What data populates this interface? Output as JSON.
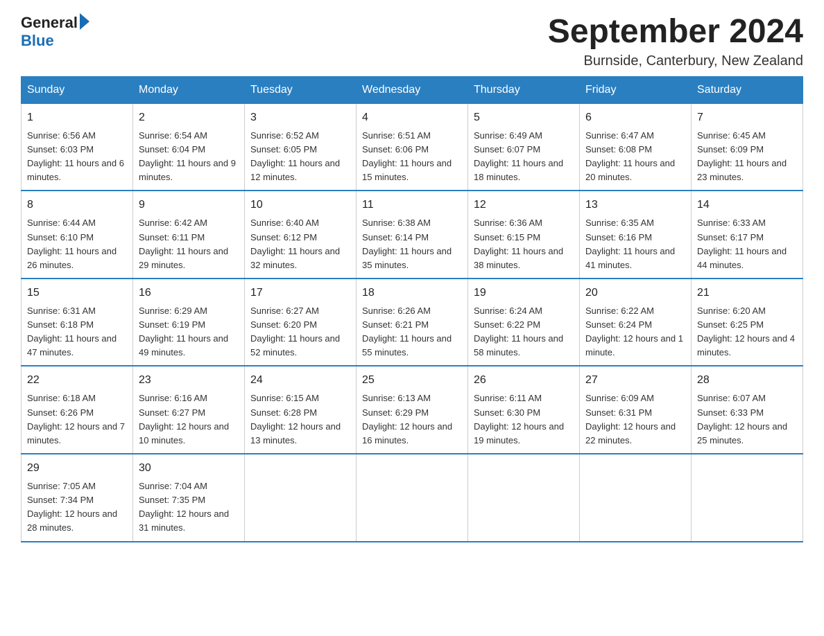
{
  "header": {
    "logo_text_black": "General",
    "logo_text_blue": "Blue",
    "month_title": "September 2024",
    "location": "Burnside, Canterbury, New Zealand"
  },
  "days_of_week": [
    "Sunday",
    "Monday",
    "Tuesday",
    "Wednesday",
    "Thursday",
    "Friday",
    "Saturday"
  ],
  "weeks": [
    [
      {
        "day": "1",
        "sunrise": "Sunrise: 6:56 AM",
        "sunset": "Sunset: 6:03 PM",
        "daylight": "Daylight: 11 hours and 6 minutes."
      },
      {
        "day": "2",
        "sunrise": "Sunrise: 6:54 AM",
        "sunset": "Sunset: 6:04 PM",
        "daylight": "Daylight: 11 hours and 9 minutes."
      },
      {
        "day": "3",
        "sunrise": "Sunrise: 6:52 AM",
        "sunset": "Sunset: 6:05 PM",
        "daylight": "Daylight: 11 hours and 12 minutes."
      },
      {
        "day": "4",
        "sunrise": "Sunrise: 6:51 AM",
        "sunset": "Sunset: 6:06 PM",
        "daylight": "Daylight: 11 hours and 15 minutes."
      },
      {
        "day": "5",
        "sunrise": "Sunrise: 6:49 AM",
        "sunset": "Sunset: 6:07 PM",
        "daylight": "Daylight: 11 hours and 18 minutes."
      },
      {
        "day": "6",
        "sunrise": "Sunrise: 6:47 AM",
        "sunset": "Sunset: 6:08 PM",
        "daylight": "Daylight: 11 hours and 20 minutes."
      },
      {
        "day": "7",
        "sunrise": "Sunrise: 6:45 AM",
        "sunset": "Sunset: 6:09 PM",
        "daylight": "Daylight: 11 hours and 23 minutes."
      }
    ],
    [
      {
        "day": "8",
        "sunrise": "Sunrise: 6:44 AM",
        "sunset": "Sunset: 6:10 PM",
        "daylight": "Daylight: 11 hours and 26 minutes."
      },
      {
        "day": "9",
        "sunrise": "Sunrise: 6:42 AM",
        "sunset": "Sunset: 6:11 PM",
        "daylight": "Daylight: 11 hours and 29 minutes."
      },
      {
        "day": "10",
        "sunrise": "Sunrise: 6:40 AM",
        "sunset": "Sunset: 6:12 PM",
        "daylight": "Daylight: 11 hours and 32 minutes."
      },
      {
        "day": "11",
        "sunrise": "Sunrise: 6:38 AM",
        "sunset": "Sunset: 6:14 PM",
        "daylight": "Daylight: 11 hours and 35 minutes."
      },
      {
        "day": "12",
        "sunrise": "Sunrise: 6:36 AM",
        "sunset": "Sunset: 6:15 PM",
        "daylight": "Daylight: 11 hours and 38 minutes."
      },
      {
        "day": "13",
        "sunrise": "Sunrise: 6:35 AM",
        "sunset": "Sunset: 6:16 PM",
        "daylight": "Daylight: 11 hours and 41 minutes."
      },
      {
        "day": "14",
        "sunrise": "Sunrise: 6:33 AM",
        "sunset": "Sunset: 6:17 PM",
        "daylight": "Daylight: 11 hours and 44 minutes."
      }
    ],
    [
      {
        "day": "15",
        "sunrise": "Sunrise: 6:31 AM",
        "sunset": "Sunset: 6:18 PM",
        "daylight": "Daylight: 11 hours and 47 minutes."
      },
      {
        "day": "16",
        "sunrise": "Sunrise: 6:29 AM",
        "sunset": "Sunset: 6:19 PM",
        "daylight": "Daylight: 11 hours and 49 minutes."
      },
      {
        "day": "17",
        "sunrise": "Sunrise: 6:27 AM",
        "sunset": "Sunset: 6:20 PM",
        "daylight": "Daylight: 11 hours and 52 minutes."
      },
      {
        "day": "18",
        "sunrise": "Sunrise: 6:26 AM",
        "sunset": "Sunset: 6:21 PM",
        "daylight": "Daylight: 11 hours and 55 minutes."
      },
      {
        "day": "19",
        "sunrise": "Sunrise: 6:24 AM",
        "sunset": "Sunset: 6:22 PM",
        "daylight": "Daylight: 11 hours and 58 minutes."
      },
      {
        "day": "20",
        "sunrise": "Sunrise: 6:22 AM",
        "sunset": "Sunset: 6:24 PM",
        "daylight": "Daylight: 12 hours and 1 minute."
      },
      {
        "day": "21",
        "sunrise": "Sunrise: 6:20 AM",
        "sunset": "Sunset: 6:25 PM",
        "daylight": "Daylight: 12 hours and 4 minutes."
      }
    ],
    [
      {
        "day": "22",
        "sunrise": "Sunrise: 6:18 AM",
        "sunset": "Sunset: 6:26 PM",
        "daylight": "Daylight: 12 hours and 7 minutes."
      },
      {
        "day": "23",
        "sunrise": "Sunrise: 6:16 AM",
        "sunset": "Sunset: 6:27 PM",
        "daylight": "Daylight: 12 hours and 10 minutes."
      },
      {
        "day": "24",
        "sunrise": "Sunrise: 6:15 AM",
        "sunset": "Sunset: 6:28 PM",
        "daylight": "Daylight: 12 hours and 13 minutes."
      },
      {
        "day": "25",
        "sunrise": "Sunrise: 6:13 AM",
        "sunset": "Sunset: 6:29 PM",
        "daylight": "Daylight: 12 hours and 16 minutes."
      },
      {
        "day": "26",
        "sunrise": "Sunrise: 6:11 AM",
        "sunset": "Sunset: 6:30 PM",
        "daylight": "Daylight: 12 hours and 19 minutes."
      },
      {
        "day": "27",
        "sunrise": "Sunrise: 6:09 AM",
        "sunset": "Sunset: 6:31 PM",
        "daylight": "Daylight: 12 hours and 22 minutes."
      },
      {
        "day": "28",
        "sunrise": "Sunrise: 6:07 AM",
        "sunset": "Sunset: 6:33 PM",
        "daylight": "Daylight: 12 hours and 25 minutes."
      }
    ],
    [
      {
        "day": "29",
        "sunrise": "Sunrise: 7:05 AM",
        "sunset": "Sunset: 7:34 PM",
        "daylight": "Daylight: 12 hours and 28 minutes."
      },
      {
        "day": "30",
        "sunrise": "Sunrise: 7:04 AM",
        "sunset": "Sunset: 7:35 PM",
        "daylight": "Daylight: 12 hours and 31 minutes."
      },
      null,
      null,
      null,
      null,
      null
    ]
  ]
}
